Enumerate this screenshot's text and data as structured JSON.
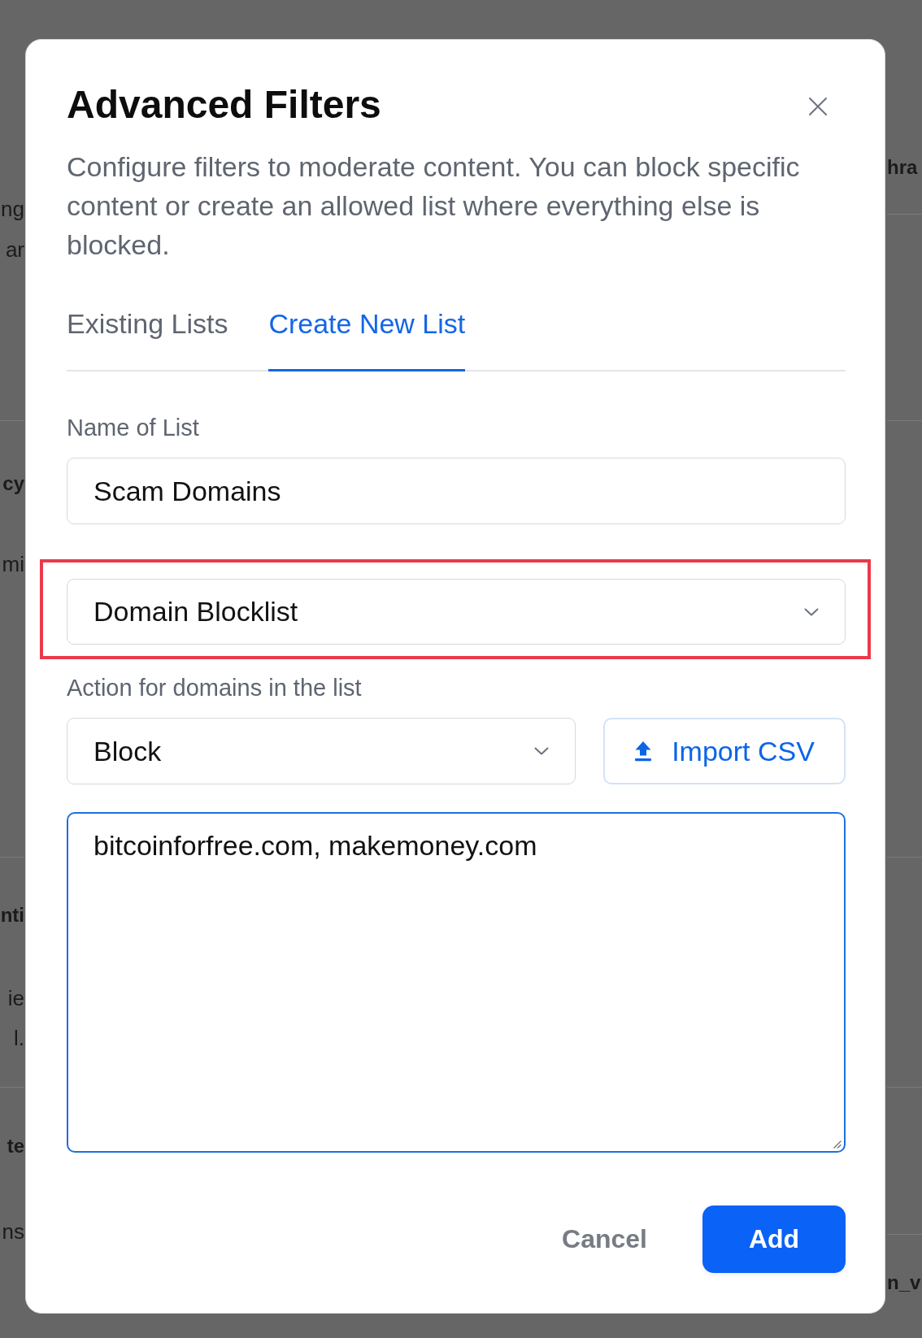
{
  "backdrop": {
    "left": [
      {
        "kind": "text",
        "text": "ng"
      },
      {
        "kind": "text",
        "text": "ar"
      },
      {
        "kind": "divider"
      },
      {
        "kind": "heading",
        "text": "cy"
      },
      {
        "kind": "text",
        "text": "mi"
      },
      {
        "kind": "divider"
      },
      {
        "kind": "title",
        "text": "nti"
      },
      {
        "kind": "text",
        "text": "ie"
      },
      {
        "kind": "text",
        "text": "l."
      },
      {
        "kind": "divider"
      },
      {
        "kind": "title",
        "text": "te"
      },
      {
        "kind": "text",
        "text": "ns"
      }
    ],
    "right": [
      {
        "kind": "heading",
        "text": "hra"
      },
      {
        "kind": "divider"
      },
      {
        "kind": "divider"
      },
      {
        "kind": "divider"
      },
      {
        "kind": "divider"
      },
      {
        "kind": "divider"
      },
      {
        "kind": "heading",
        "text": "n_v"
      }
    ]
  },
  "dialog": {
    "title": "Advanced Filters",
    "description": "Configure filters to moderate content. You can block specific content or create an allowed list where everything else is blocked.",
    "tabs": [
      {
        "label": "Existing Lists",
        "selected": false
      },
      {
        "label": "Create New List",
        "selected": true
      }
    ],
    "name_field": {
      "label": "Name of List",
      "value": "Scam Domains"
    },
    "list_type": {
      "value": "Domain Blocklist",
      "highlighted": true
    },
    "action": {
      "label": "Action for domains in the list",
      "value": "Block"
    },
    "import_button": {
      "label": "Import CSV"
    },
    "domains": {
      "value": "bitcoinforfree.com, makemoney.com",
      "focused": true
    },
    "buttons": [
      {
        "label": "Cancel",
        "kind": "secondary"
      },
      {
        "label": "Add",
        "kind": "primary"
      }
    ]
  }
}
